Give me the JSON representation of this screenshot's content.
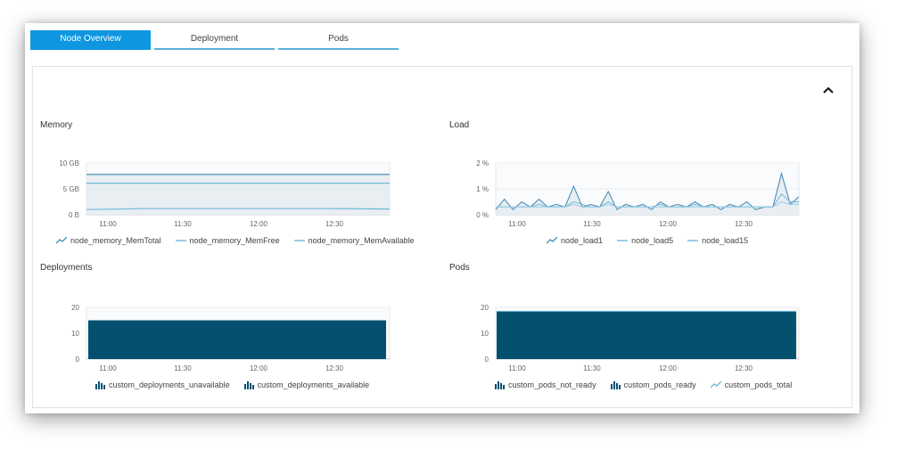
{
  "tabs": [
    {
      "label": "Node Overview",
      "active": true
    },
    {
      "label": "Deployment",
      "active": false
    },
    {
      "label": "Pods",
      "active": false
    }
  ],
  "colors": {
    "accent": "#0e96e0",
    "dark_series": "#03506f",
    "line_mid": "#4b90b8",
    "line_light": "#6fb8db",
    "fill": "#e6ecf1"
  },
  "panel": {
    "collapse_icon": "chevron-up-icon"
  },
  "memory": {
    "title": "Memory",
    "y_ticks": [
      "10 GB",
      "5 GB",
      "0 B"
    ],
    "x_ticks": [
      "11:00",
      "11:30",
      "12:00",
      "12:30"
    ],
    "legend": [
      {
        "label": "node_memory_MemTotal",
        "icon": "area-chart-icon"
      },
      {
        "label": "node_memory_MemFree",
        "icon": "line-icon"
      },
      {
        "label": "node_memory_MemAvailable",
        "icon": "line-icon"
      }
    ]
  },
  "load": {
    "title": "Load",
    "y_ticks": [
      "2 %",
      "1 %",
      "0 %"
    ],
    "x_ticks": [
      "11:00",
      "11:30",
      "12:00",
      "12:30"
    ],
    "legend": [
      {
        "label": "node_load1",
        "icon": "area-chart-icon"
      },
      {
        "label": "node_load5",
        "icon": "line-icon"
      },
      {
        "label": "node_load15",
        "icon": "line-icon"
      }
    ]
  },
  "deployments": {
    "title": "Deployments",
    "y_ticks": [
      "20",
      "10",
      "0"
    ],
    "x_ticks": [
      "11:00",
      "11:30",
      "12:00",
      "12:30"
    ],
    "legend": [
      {
        "label": "custom_deployments_unavailable",
        "icon": "bar-chart-icon"
      },
      {
        "label": "custom_deployments_available",
        "icon": "bar-chart-icon"
      }
    ]
  },
  "pods": {
    "title": "Pods",
    "y_ticks": [
      "20",
      "10",
      "0"
    ],
    "x_ticks": [
      "11:00",
      "11:30",
      "12:00",
      "12:30"
    ],
    "legend": [
      {
        "label": "custom_pods_not_ready",
        "icon": "bar-chart-icon"
      },
      {
        "label": "custom_pods_ready",
        "icon": "bar-chart-icon"
      },
      {
        "label": "custom_pods_total",
        "icon": "area-chart-icon"
      }
    ]
  },
  "chart_data": [
    {
      "type": "line",
      "title": "Memory",
      "y_unit": "GB",
      "ylim": [
        0,
        10
      ],
      "x_range": [
        "10:55",
        "13:00"
      ],
      "series": [
        {
          "name": "node_memory_MemTotal",
          "values": [
            7.8,
            7.8,
            7.8,
            7.8,
            7.8,
            7.8
          ]
        },
        {
          "name": "node_memory_MemFree",
          "values": [
            6.1,
            6.1,
            6.1,
            6.1,
            6.1,
            6.1
          ]
        },
        {
          "name": "node_memory_MemAvailable",
          "values": [
            1.0,
            1.2,
            1.2,
            1.2,
            1.2,
            1.1
          ]
        }
      ]
    },
    {
      "type": "line",
      "title": "Load",
      "y_unit": "%",
      "ylim": [
        0,
        2
      ],
      "x_range": [
        "10:55",
        "13:00"
      ],
      "series": [
        {
          "name": "node_load1",
          "values": [
            0.2,
            0.6,
            0.2,
            0.5,
            0.3,
            0.6,
            0.3,
            0.4,
            0.3,
            1.1,
            0.3,
            0.4,
            0.3,
            0.9,
            0.2,
            0.4,
            0.3,
            0.4,
            0.2,
            0.5,
            0.3,
            0.4,
            0.3,
            0.5,
            0.3,
            0.4,
            0.2,
            0.4,
            0.3,
            0.5,
            0.2,
            0.3,
            0.3,
            1.6,
            0.4,
            0.7
          ]
        },
        {
          "name": "node_load5",
          "values": [
            0.3,
            0.3,
            0.3,
            0.3,
            0.3,
            0.4,
            0.3,
            0.3,
            0.3,
            0.5,
            0.4,
            0.3,
            0.3,
            0.5,
            0.3,
            0.3,
            0.3,
            0.3,
            0.3,
            0.4,
            0.3,
            0.3,
            0.3,
            0.4,
            0.3,
            0.3,
            0.3,
            0.3,
            0.3,
            0.3,
            0.3,
            0.3,
            0.3,
            0.8,
            0.5,
            0.5
          ]
        },
        {
          "name": "node_load15",
          "values": [
            0.3,
            0.3,
            0.3,
            0.3,
            0.3,
            0.3,
            0.3,
            0.3,
            0.3,
            0.4,
            0.3,
            0.3,
            0.3,
            0.4,
            0.3,
            0.3,
            0.3,
            0.3,
            0.3,
            0.3,
            0.3,
            0.3,
            0.3,
            0.3,
            0.3,
            0.3,
            0.3,
            0.3,
            0.3,
            0.3,
            0.3,
            0.3,
            0.3,
            0.5,
            0.4,
            0.4
          ]
        }
      ]
    },
    {
      "type": "area",
      "title": "Deployments",
      "ylim": [
        0,
        20
      ],
      "x_range": [
        "10:55",
        "13:00"
      ],
      "series": [
        {
          "name": "custom_deployments_unavailable",
          "values": [
            0,
            0
          ]
        },
        {
          "name": "custom_deployments_available",
          "values": [
            15,
            15
          ]
        }
      ]
    },
    {
      "type": "area",
      "title": "Pods",
      "ylim": [
        0,
        20
      ],
      "x_range": [
        "10:55",
        "13:00"
      ],
      "series": [
        {
          "name": "custom_pods_not_ready",
          "values": [
            0,
            0
          ]
        },
        {
          "name": "custom_pods_ready",
          "values": [
            18.5,
            18.5
          ]
        },
        {
          "name": "custom_pods_total",
          "values": [
            18.5,
            18.5
          ]
        }
      ]
    }
  ]
}
